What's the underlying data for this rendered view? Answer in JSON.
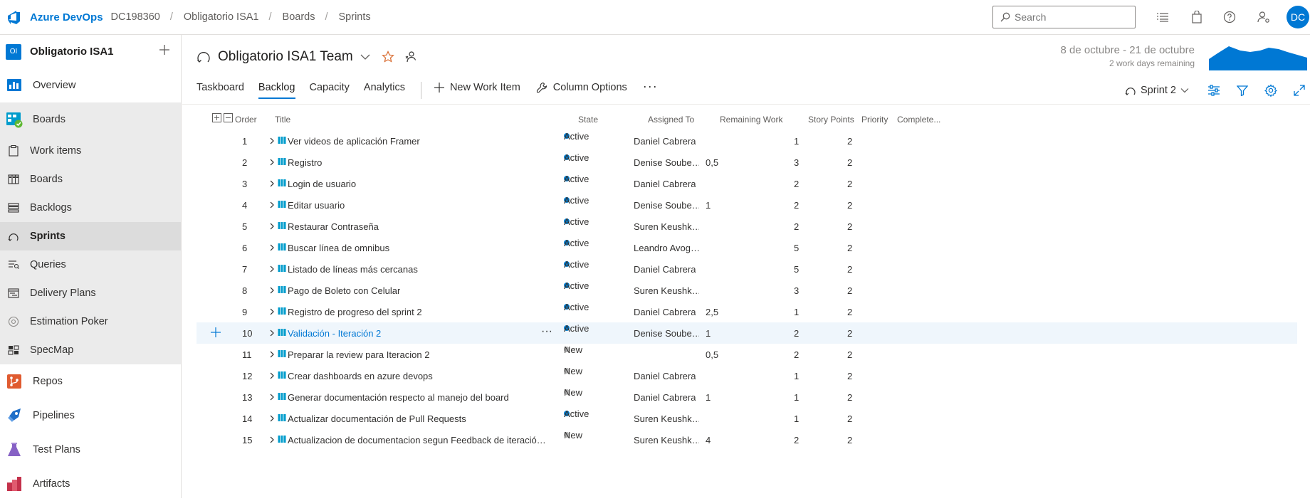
{
  "topbar": {
    "brand": "Azure DevOps",
    "breadcrumbs": [
      "DC198360",
      "Obligatorio ISA1",
      "Boards",
      "Sprints"
    ],
    "search_placeholder": "Search",
    "avatar_initials": "DC",
    "icons": [
      "list-icon",
      "shopping-bag-icon",
      "help-icon",
      "person-settings-icon"
    ]
  },
  "sidebar": {
    "project_badge": "OI",
    "project_name": "Obligatorio ISA1",
    "items": [
      {
        "label": "Overview",
        "icon": "overview-icon",
        "color": "#0078d4"
      },
      {
        "label": "Boards",
        "icon": "boards-icon",
        "color": "#009ccc"
      },
      {
        "label": "Work items",
        "icon": "work-items-icon",
        "sub": true
      },
      {
        "label": "Boards",
        "icon": "kanban-icon",
        "sub": true
      },
      {
        "label": "Backlogs",
        "icon": "backlogs-icon",
        "sub": true
      },
      {
        "label": "Sprints",
        "icon": "sprints-icon",
        "sub": true,
        "active": true
      },
      {
        "label": "Queries",
        "icon": "queries-icon",
        "sub": true
      },
      {
        "label": "Delivery Plans",
        "icon": "delivery-plans-icon",
        "sub": true
      },
      {
        "label": "Estimation Poker",
        "icon": "estimation-poker-icon",
        "sub": true
      },
      {
        "label": "SpecMap",
        "icon": "specmap-icon",
        "sub": true
      },
      {
        "label": "Repos",
        "icon": "repos-icon",
        "color": "#e05b30"
      },
      {
        "label": "Pipelines",
        "icon": "pipelines-icon",
        "color": "#1e6ec8"
      },
      {
        "label": "Test Plans",
        "icon": "test-plans-icon",
        "color": "#8661c5"
      },
      {
        "label": "Artifacts",
        "icon": "artifacts-icon",
        "color": "#c4314b"
      }
    ]
  },
  "header": {
    "team_name": "Obligatorio ISA1 Team",
    "date_range": "8 de octubre - 21 de octubre",
    "days_remaining": "2 work days remaining",
    "tabs": [
      "Taskboard",
      "Backlog",
      "Capacity",
      "Analytics"
    ],
    "active_tab": "Backlog",
    "new_work_item": "New Work Item",
    "column_options": "Column Options",
    "more": "···",
    "sprint": "Sprint 2"
  },
  "colors": {
    "active_state": "#007acc",
    "new_state": "#b2b2b2",
    "accent": "#0078d4"
  },
  "grid": {
    "columns": [
      "Order",
      "Title",
      "State",
      "Assigned To",
      "Remaining Work",
      "Story Points",
      "Priority",
      "Complete..."
    ],
    "rows": [
      {
        "order": "1",
        "title": "Ver videos de aplicación Framer",
        "state": "Active",
        "assigned": "Daniel Cabrera",
        "remaining": "",
        "points": "1",
        "priority": "2"
      },
      {
        "order": "2",
        "title": "Registro",
        "state": "Active",
        "assigned": "Denise Soube…",
        "remaining": "0,5",
        "points": "3",
        "priority": "2"
      },
      {
        "order": "3",
        "title": "Login de usuario",
        "state": "Active",
        "assigned": "Daniel Cabrera",
        "remaining": "",
        "points": "2",
        "priority": "2"
      },
      {
        "order": "4",
        "title": "Editar usuario",
        "state": "Active",
        "assigned": "Denise Soube…",
        "remaining": "1",
        "points": "2",
        "priority": "2"
      },
      {
        "order": "5",
        "title": "Restaurar Contraseña",
        "state": "Active",
        "assigned": "Suren Keushk…",
        "remaining": "",
        "points": "2",
        "priority": "2"
      },
      {
        "order": "6",
        "title": "Buscar línea de omnibus",
        "state": "Active",
        "assigned": "Leandro Avog…",
        "remaining": "",
        "points": "5",
        "priority": "2"
      },
      {
        "order": "7",
        "title": "Listado de líneas más cercanas",
        "state": "Active",
        "assigned": "Daniel Cabrera",
        "remaining": "",
        "points": "5",
        "priority": "2"
      },
      {
        "order": "8",
        "title": "Pago de Boleto con Celular",
        "state": "Active",
        "assigned": "Suren Keushk…",
        "remaining": "",
        "points": "3",
        "priority": "2"
      },
      {
        "order": "9",
        "title": "Registro de progreso del sprint 2",
        "state": "Active",
        "assigned": "Daniel Cabrera",
        "remaining": "2,5",
        "points": "1",
        "priority": "2"
      },
      {
        "order": "10",
        "title": "Validación - Iteración 2",
        "state": "Active",
        "assigned": "Denise Soube…",
        "remaining": "1",
        "points": "2",
        "priority": "2",
        "selected": true
      },
      {
        "order": "11",
        "title": "Preparar la review para Iteracion 2",
        "state": "New",
        "assigned": "",
        "remaining": "0,5",
        "points": "2",
        "priority": "2"
      },
      {
        "order": "12",
        "title": "Crear dashboards en azure devops",
        "state": "New",
        "assigned": "Daniel Cabrera",
        "remaining": "",
        "points": "1",
        "priority": "2"
      },
      {
        "order": "13",
        "title": "Generar documentación respecto al manejo del board",
        "state": "New",
        "assigned": "Daniel Cabrera",
        "remaining": "1",
        "points": "1",
        "priority": "2"
      },
      {
        "order": "14",
        "title": "Actualizar documentación de Pull Requests",
        "state": "Active",
        "assigned": "Suren Keushk…",
        "remaining": "",
        "points": "1",
        "priority": "2"
      },
      {
        "order": "15",
        "title": "Actualizacion de documentacion segun Feedback de iteració…",
        "state": "New",
        "assigned": "Suren Keushk…",
        "remaining": "4",
        "points": "2",
        "priority": "2"
      }
    ]
  }
}
